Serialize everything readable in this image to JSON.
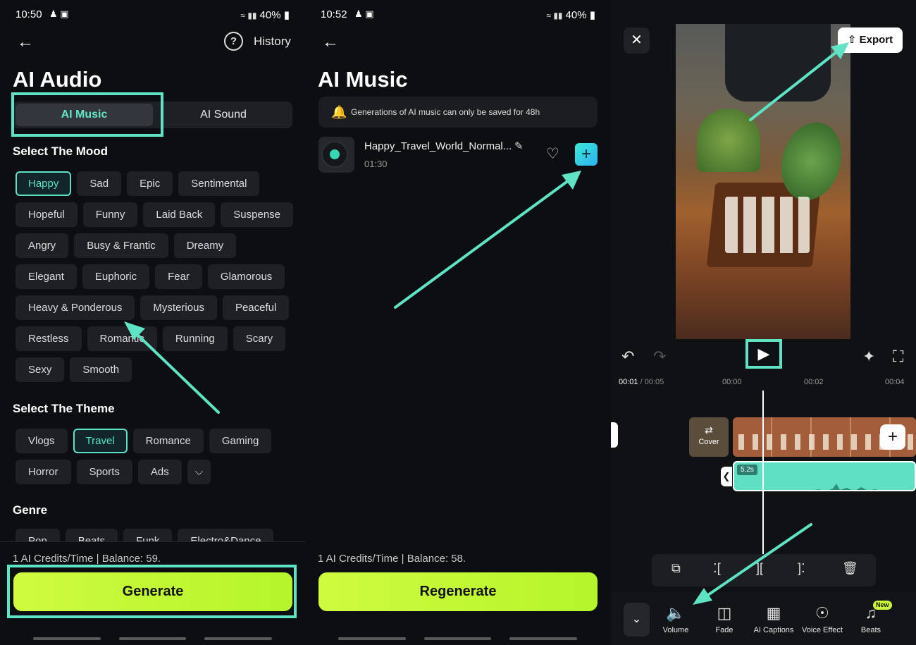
{
  "panel1": {
    "status": {
      "time": "10:50",
      "battery": "40%"
    },
    "history_label": "History",
    "help_icon": "?",
    "title": "AI Audio",
    "tabs": [
      {
        "label": "AI Music"
      },
      {
        "label": "AI Sound"
      }
    ],
    "mood_title": "Select The Mood",
    "mood_rows": [
      [
        "Happy",
        "Sad",
        "Epic",
        "Sentimental"
      ],
      [
        "Hopeful",
        "Funny",
        "Laid Back",
        "Suspense"
      ],
      [
        "Angry",
        "Busy & Frantic",
        "Dreamy"
      ],
      [
        "Elegant",
        "Euphoric",
        "Fear",
        "Glamorous"
      ],
      [
        "Heavy & Ponderous",
        "Mysterious",
        "Peaceful"
      ],
      [
        "Restless",
        "Romantic",
        "Running",
        "Scary"
      ],
      [
        "Sexy",
        "Smooth"
      ]
    ],
    "mood_selected": "Happy",
    "theme_title": "Select The Theme",
    "theme_rows": [
      [
        "Vlogs",
        "Travel",
        "Romance",
        "Gaming"
      ],
      [
        "Horror",
        "Sports",
        "Ads"
      ]
    ],
    "theme_selected": "Travel",
    "genre_title": "Genre",
    "genre_items": [
      "Pop",
      "Beats",
      "Funk",
      "Electro&Dance"
    ],
    "credits": "1 AI Credits/Time | Balance: 59.",
    "generate_label": "Generate"
  },
  "panel2": {
    "status": {
      "time": "10:52",
      "battery": "40%"
    },
    "title": "AI Music",
    "notice": "Generations of AI music can only be saved for 48h",
    "track": {
      "name": "Happy_Travel_World_Normal...",
      "duration": "01:30"
    },
    "credits": "1 AI Credits/Time | Balance: 58.",
    "regenerate_label": "Regenerate"
  },
  "panel3": {
    "export_label": "Export",
    "time_current": "00:01",
    "time_total": "/ 00:05",
    "ruler": [
      "00:00",
      "00:02",
      "00:04"
    ],
    "cover_label": "Cover",
    "audio_tag": "5.2s",
    "bottom_tools": [
      {
        "label": "Volume",
        "icon": "volume-icon"
      },
      {
        "label": "Fade",
        "icon": "fade-icon"
      },
      {
        "label": "AI Captions",
        "icon": "ai-captions-icon"
      },
      {
        "label": "Voice Effect",
        "icon": "voice-effect-icon"
      },
      {
        "label": "Beats",
        "icon": "beats-icon"
      }
    ],
    "new_badge": "New"
  },
  "colors": {
    "accent": "#5ee3c4",
    "generate": "#c6f83a",
    "background": "#0d0e11"
  }
}
